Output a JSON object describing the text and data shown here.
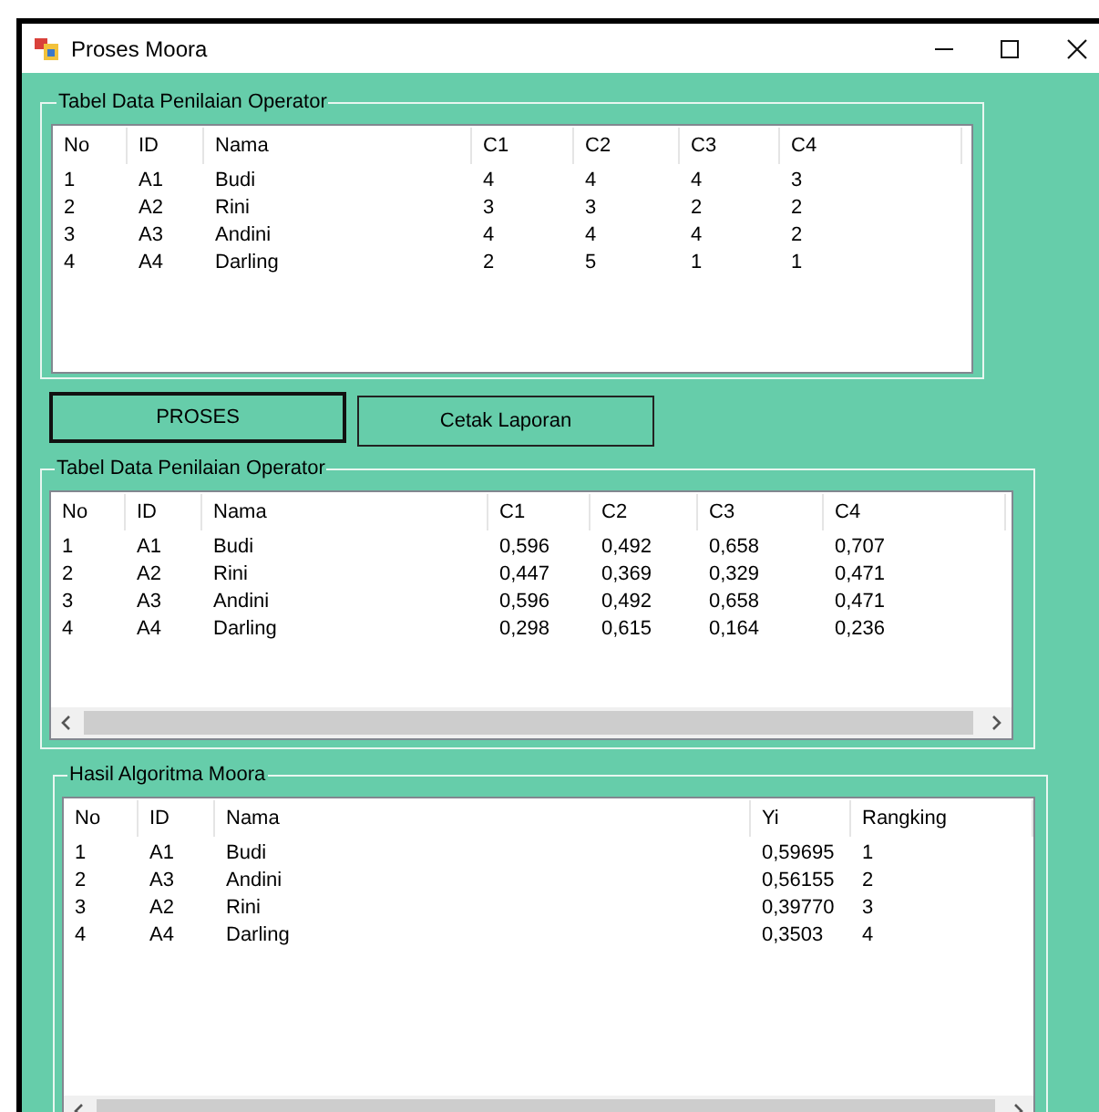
{
  "window": {
    "title": "Proses Moora"
  },
  "sections": [
    {
      "kind": "group",
      "title": "Tabel Data Penilaian Operator",
      "horizontal_scrollbar": false,
      "columns": [
        "No",
        "ID",
        "Nama",
        "C1",
        "C2",
        "C3",
        "C4"
      ],
      "rows": [
        [
          "1",
          "A1",
          "Budi",
          "4",
          "4",
          "4",
          "3"
        ],
        [
          "2",
          "A2",
          "Rini",
          "3",
          "3",
          "2",
          "2"
        ],
        [
          "3",
          "A3",
          "Andini",
          "4",
          "4",
          "4",
          "2"
        ],
        [
          "4",
          "A4",
          "Darling",
          "2",
          "5",
          "1",
          "1"
        ]
      ]
    },
    {
      "kind": "buttons",
      "buttons": [
        {
          "label": "PROSES",
          "focused": true
        },
        {
          "label": "Cetak Laporan",
          "focused": false
        }
      ]
    },
    {
      "kind": "group",
      "title": "Tabel Data Penilaian Operator",
      "horizontal_scrollbar": true,
      "columns": [
        "No",
        "ID",
        "Nama",
        "C1",
        "C2",
        "C3",
        "C4"
      ],
      "rows": [
        [
          "1",
          "A1",
          "Budi",
          "0,596",
          "0,492",
          "0,658",
          "0,707"
        ],
        [
          "2",
          "A2",
          "Rini",
          "0,447",
          "0,369",
          "0,329",
          "0,471"
        ],
        [
          "3",
          "A3",
          "Andini",
          "0,596",
          "0,492",
          "0,658",
          "0,471"
        ],
        [
          "4",
          "A4",
          "Darling",
          "0,298",
          "0,615",
          "0,164",
          "0,236"
        ]
      ]
    },
    {
      "kind": "group",
      "title": "Hasil Algoritma Moora",
      "horizontal_scrollbar": true,
      "columns": [
        "No",
        "ID",
        "Nama",
        "Yi",
        "Rangking"
      ],
      "rows": [
        [
          "1",
          "A1",
          "Budi",
          "0,59695",
          "1"
        ],
        [
          "2",
          "A3",
          "Andini",
          "0,56155",
          "2"
        ],
        [
          "3",
          "A2",
          "Rini",
          "0,39770",
          "3"
        ],
        [
          "4",
          "A4",
          "Darling",
          "0,3503",
          "4"
        ]
      ]
    }
  ]
}
